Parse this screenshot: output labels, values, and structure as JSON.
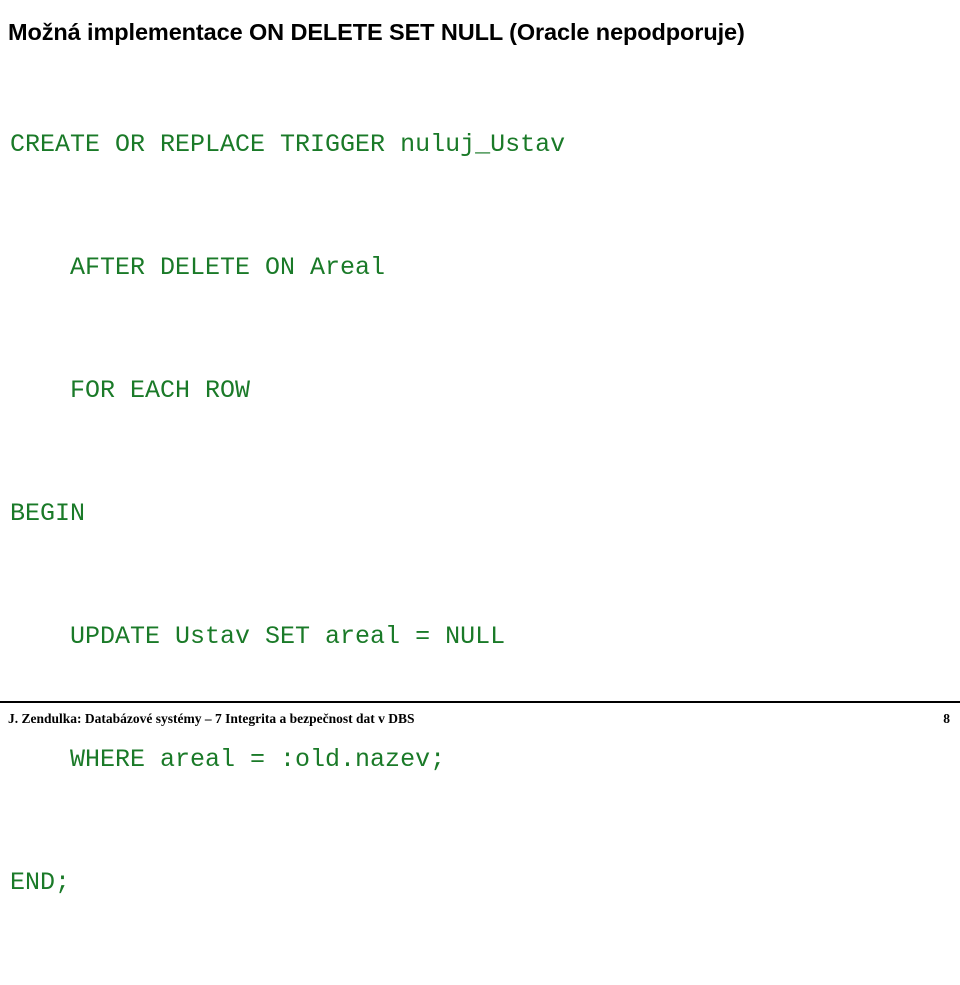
{
  "slide": {
    "title": "Možná implementace ON DELETE SET NULL (Oracle nepodporuje)",
    "code": {
      "language": "plsql",
      "color": "#1a7a28",
      "lines": [
        "CREATE OR REPLACE TRIGGER nuluj_Ustav",
        "    AFTER DELETE ON Areal",
        "    FOR EACH ROW",
        "BEGIN",
        "    UPDATE Ustav SET areal = NULL",
        "    WHERE areal = :old.nazev;",
        "END;"
      ]
    },
    "footer": {
      "text": "J. Zendulka: Databázové systémy – 7 Integrita a bezpečnost dat v DBS",
      "page_number": "8"
    },
    "colors": {
      "background": "#ffffff",
      "title": "#000000",
      "code": "#1a7a28",
      "footer": "#000000",
      "rule": "#000000"
    }
  }
}
